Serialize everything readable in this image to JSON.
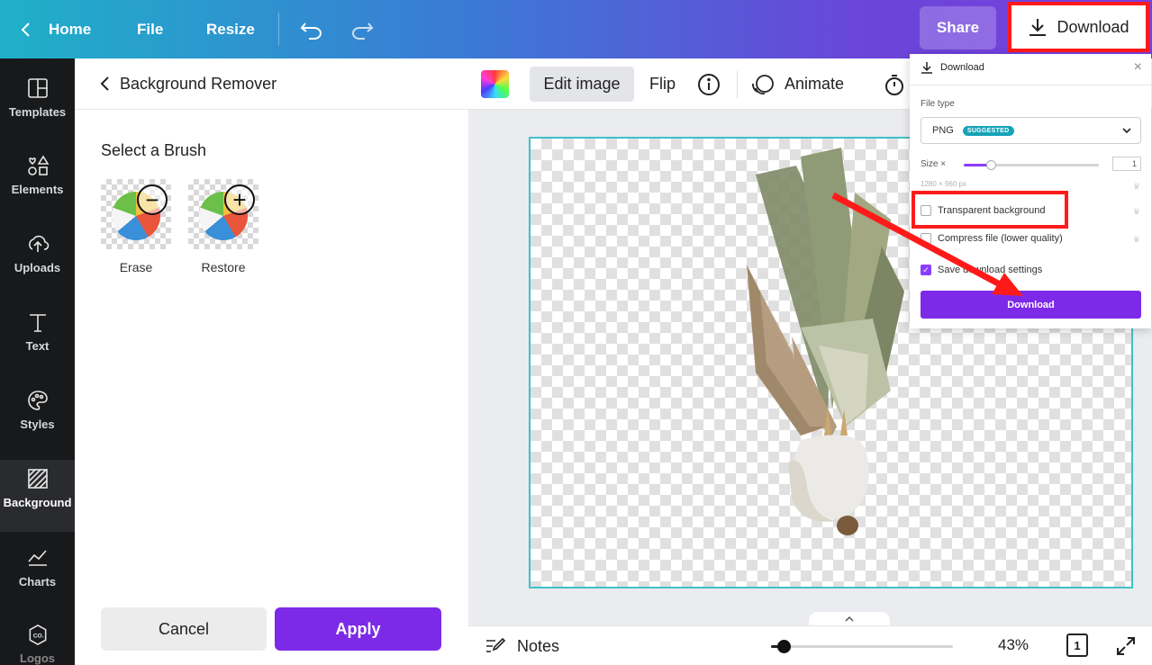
{
  "topbar": {
    "home": "Home",
    "file": "File",
    "resize": "Resize",
    "share": "Share",
    "download": "Download"
  },
  "rail": {
    "items": [
      {
        "label": "Templates",
        "icon": "templates-icon"
      },
      {
        "label": "Elements",
        "icon": "elements-icon"
      },
      {
        "label": "Uploads",
        "icon": "uploads-icon"
      },
      {
        "label": "Text",
        "icon": "text-icon"
      },
      {
        "label": "Styles",
        "icon": "styles-icon"
      },
      {
        "label": "Background",
        "icon": "background-icon"
      },
      {
        "label": "Charts",
        "icon": "charts-icon"
      },
      {
        "label": "Logos",
        "icon": "logos-icon"
      }
    ]
  },
  "panel": {
    "title": "Background Remover",
    "brush_title": "Select a Brush",
    "brushes": [
      {
        "label": "Erase",
        "symbol": "−"
      },
      {
        "label": "Restore",
        "symbol": "+"
      }
    ],
    "cancel": "Cancel",
    "apply": "Apply"
  },
  "toolbar": {
    "edit_image": "Edit image",
    "flip": "Flip",
    "animate": "Animate"
  },
  "bottom": {
    "notes": "Notes",
    "zoom": "43%",
    "pages": "1",
    "zoom_level": 0.07
  },
  "download_popup": {
    "title": "Download",
    "file_type_label": "File type",
    "file_type": "PNG",
    "suggested": "SUGGESTED",
    "size_label": "Size ×",
    "size_value": "1",
    "size_level": 0.2,
    "px_note": "1280 × 960 px",
    "transparent_bg": "Transparent background",
    "compress": "Compress file (lower quality)",
    "save_settings": "Save download settings",
    "download_button": "Download"
  },
  "colors": {
    "accent": "#7d2ae8",
    "highlight": "#ff1a1a",
    "canvas_border": "#3fc1c9"
  }
}
